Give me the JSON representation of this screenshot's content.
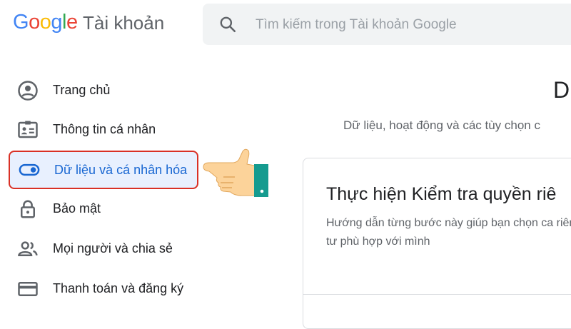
{
  "header": {
    "logo_letters": [
      {
        "ch": "G",
        "color": "#4285F4"
      },
      {
        "ch": "o",
        "color": "#EA4335"
      },
      {
        "ch": "o",
        "color": "#FBBC05"
      },
      {
        "ch": "g",
        "color": "#4285F4"
      },
      {
        "ch": "l",
        "color": "#34A853"
      },
      {
        "ch": "e",
        "color": "#EA4335"
      }
    ],
    "product_name": "Tài khoản",
    "search_placeholder": "Tìm kiếm trong Tài khoản Google"
  },
  "sidebar": {
    "items": [
      {
        "label": "Trang chủ",
        "icon": "account-circle-icon"
      },
      {
        "label": "Thông tin cá nhân",
        "icon": "id-card-icon"
      },
      {
        "label": "Dữ liệu và cá nhân hóa",
        "icon": "toggle-icon",
        "active": true
      },
      {
        "label": "Bảo mật",
        "icon": "lock-icon"
      },
      {
        "label": "Mọi người và chia sẻ",
        "icon": "people-icon"
      },
      {
        "label": "Thanh toán và đăng ký",
        "icon": "credit-card-icon"
      }
    ]
  },
  "main": {
    "title_fragment": "D",
    "subtitle": "Dữ liệu, hoạt động và các tùy chọn c",
    "card": {
      "title": "Thực hiện Kiểm tra quyền riê",
      "description": "Hướng dẫn từng bước này giúp bạn chọn ca riêng tư phù hợp với mình"
    }
  },
  "colors": {
    "active_bg": "#e8f0fe",
    "active_text": "#1967d2",
    "highlight_border": "#d93025",
    "search_bg": "#f1f3f4"
  }
}
